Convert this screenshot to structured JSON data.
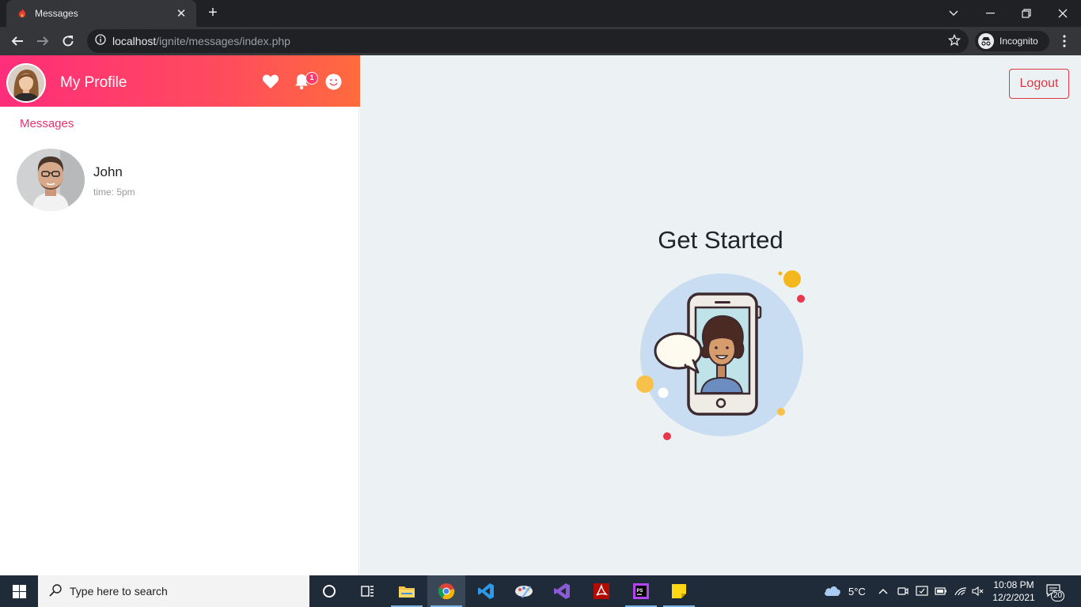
{
  "browser": {
    "tab_title": "Messages",
    "url_host": "localhost",
    "url_path": "/ignite/messages/index.php",
    "profile_label": "Incognito"
  },
  "header": {
    "title": "My Profile",
    "notification_count": "1"
  },
  "sidebar": {
    "section_title": "Messages",
    "contacts": [
      {
        "name": "John",
        "time": "time: 5pm"
      }
    ]
  },
  "main": {
    "logout_label": "Logout",
    "heading": "Get Started"
  },
  "taskbar": {
    "search_placeholder": "Type here to search",
    "weather": "5°C",
    "time": "10:08 PM",
    "date": "12/2/2021",
    "notification_count": "20"
  },
  "colors": {
    "accent": "#ea2f6e",
    "danger": "#dc3545",
    "main_bg": "#ecf2f4"
  }
}
